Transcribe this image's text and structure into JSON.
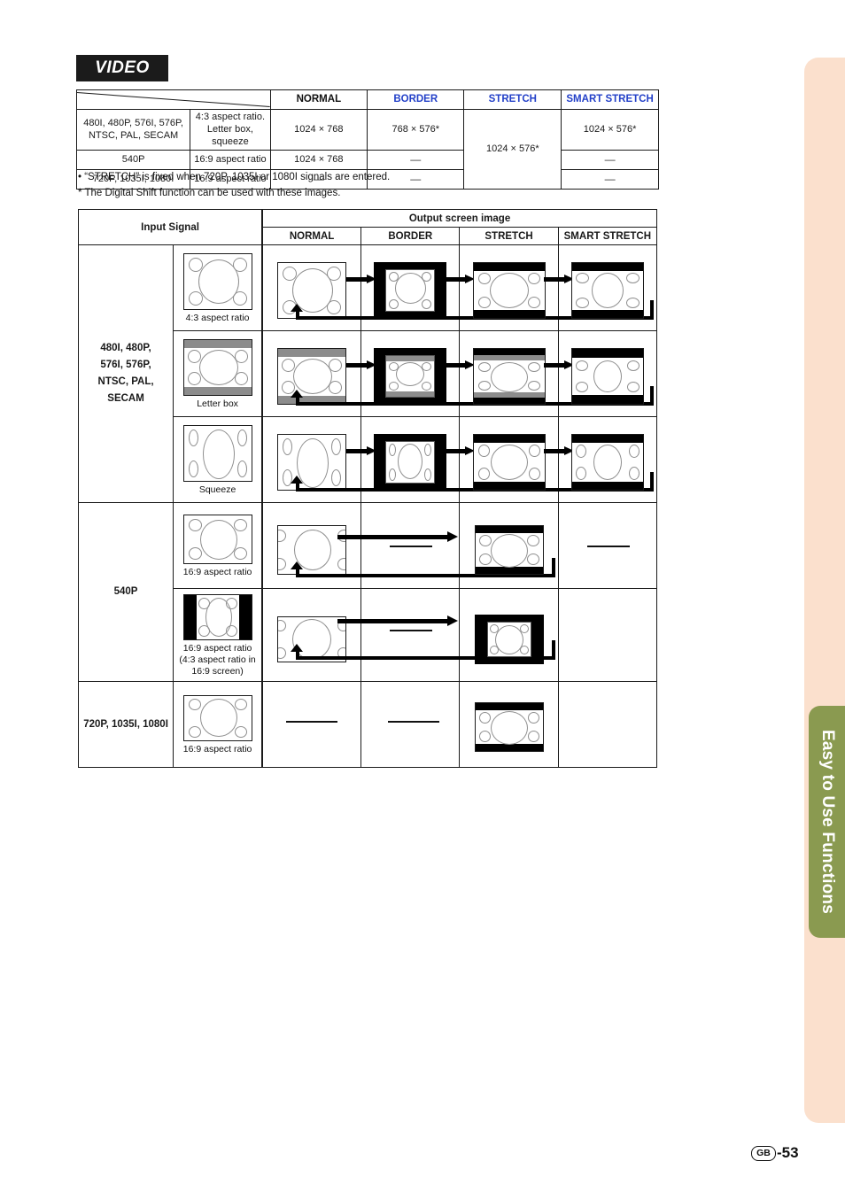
{
  "page": {
    "section_badge": "VIDEO",
    "page_number": "-53",
    "region_code": "GB",
    "side_tab_label": "Easy to Use Functions",
    "colors": {
      "accent_blue": "#2340c8",
      "side_tab_green": "#8a9a50",
      "side_strip_peach": "#fbe0cd",
      "badge_black": "#1b1b1b",
      "letterbox_gray": "#8c8c8c"
    }
  },
  "resolution_table": {
    "columns": [
      "NORMAL",
      "BORDER",
      "STRETCH",
      "SMART STRETCH"
    ],
    "column_colors": [
      "black",
      "blue",
      "blue",
      "blue"
    ],
    "rows": [
      {
        "signal": "480I, 480P, 576I, 576P,\nNTSC, PAL, SECAM",
        "signal_line1": "480I, 480P, 576I, 576P,",
        "signal_line2": "NTSC, PAL, SECAM",
        "aspect_line1": "4:3 aspect ratio.",
        "aspect_line2": "Letter box, squeeze",
        "normal": "1024 × 768",
        "border": "768 × 576*",
        "stretch": "1024 × 576*",
        "smart_stretch": "1024 × 576*"
      },
      {
        "signal_line1": "540P",
        "signal_line2": "",
        "aspect_line1": "16:9 aspect ratio",
        "aspect_line2": "",
        "normal": "1024 × 768",
        "border": "—",
        "smart_stretch": "—"
      },
      {
        "signal_line1": "720P, 1035I, 1080I",
        "signal_line2": "",
        "aspect_line1": "16:9 aspect ratio",
        "aspect_line2": "",
        "normal": "—",
        "border": "—",
        "smart_stretch": "—"
      }
    ]
  },
  "notes": {
    "note1": "• “STRETCH” is fixed when 720P, 1035I or 1080I signals are entered.",
    "note2": "* The Digital Shift function can be used with these images."
  },
  "diagram_table": {
    "input_header": "Input Signal",
    "output_header": "Output screen image",
    "output_columns": [
      "NORMAL",
      "BORDER",
      "STRETCH",
      "SMART STRETCH"
    ],
    "groups": [
      {
        "label_line1": "480I, 480P,",
        "label_line2": "576I, 576P,",
        "label_line3": "NTSC, PAL, SECAM",
        "rows": [
          {
            "caption": "4:3 aspect ratio"
          },
          {
            "caption": "Letter box"
          },
          {
            "caption": "Squeeze"
          }
        ]
      },
      {
        "label_line1": "540P",
        "label_line2": "",
        "label_line3": "",
        "rows": [
          {
            "caption": "16:9 aspect ratio"
          },
          {
            "caption_line1": "16:9 aspect ratio",
            "caption_line2": "(4:3 aspect ratio in",
            "caption_line3": "16:9 screen)"
          }
        ]
      },
      {
        "label_line1": "720P, 1035I, 1080I",
        "label_line2": "",
        "label_line3": "",
        "rows": [
          {
            "caption": "16:9 aspect ratio"
          }
        ]
      }
    ]
  }
}
